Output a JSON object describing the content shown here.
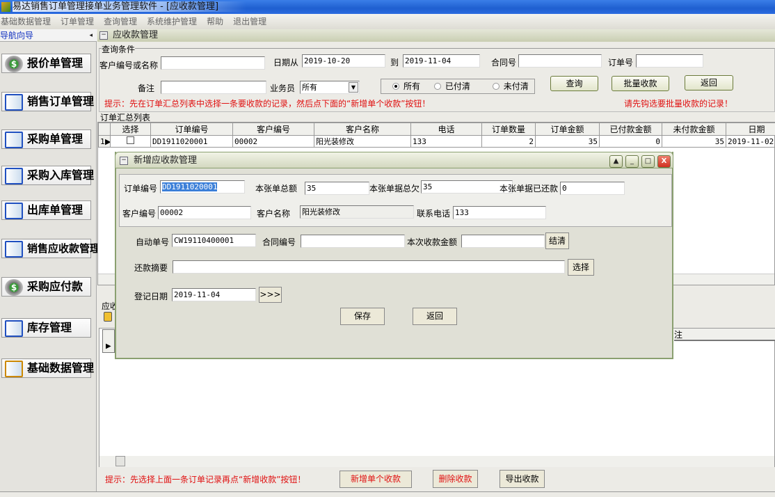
{
  "window": {
    "title": "易达销售订单管理接单业务管理软件 - [应收款管理]"
  },
  "menu": [
    "基础数据管理",
    "订单管理",
    "查询管理",
    "系统维护管理",
    "帮助",
    "退出管理"
  ],
  "nav": {
    "title": "导航向导",
    "collapse_icon": "◂"
  },
  "sidebar": [
    "报价单管理",
    "销售订单管理",
    "采购单管理",
    "采购入库管理",
    "出库单管理",
    "销售应收款管理",
    "采购应付款",
    "库存管理",
    "基础数据管理"
  ],
  "panel": {
    "title": "应收款管理"
  },
  "query": {
    "group_label": "查询条件",
    "customer_label": "客户编号或名称",
    "customer_value": "",
    "date_from_label": "日期从",
    "date_from": "2019-10-20",
    "date_to_label": "到",
    "date_to": "2019-11-04",
    "contract_label": "合同号",
    "contract_value": "",
    "order_label": "订单号",
    "order_value": "",
    "remark_label": "备注",
    "remark_value": "",
    "salesman_label": "业务员",
    "salesman_value": "所有",
    "radio_all": "所有",
    "radio_paid": "已付清",
    "radio_unpaid": "未付清",
    "search_btn": "查询",
    "batch_btn": "批量收款",
    "back_btn": "返回",
    "hint": "提示：先在订单汇总列表中选择一条要收款的记录，然后点下面的“新增单个收款”按钮！",
    "batch_hint": "请先钩选要批量收款的记录！"
  },
  "orders": {
    "label": "订单汇总列表",
    "columns": [
      "选择",
      "订单编号",
      "客户编号",
      "客户名称",
      "电话",
      "订单数量",
      "订单金额",
      "已付款金额",
      "未付款金额",
      "日期"
    ],
    "rows": [
      {
        "index": "1",
        "order_no": "DD1911020001",
        "cust_no": "00002",
        "cust_name": "阳光装修改",
        "phone": "133",
        "qty": "2",
        "amount": "35",
        "paid": "0",
        "unpaid": "35",
        "date": "2019-11-02"
      }
    ]
  },
  "receipts": {
    "label": "应收",
    "col_partial": "注"
  },
  "bottom": {
    "hint": "提示：先选择上面一条订单记录再点“新增收款”按钮！",
    "add_btn": "新增单个收款",
    "del_btn": "删除收款",
    "export_btn": "导出收款"
  },
  "dialog": {
    "title": "新增应收款管理",
    "order_no_label": "订单编号",
    "order_no": "DD1911020001",
    "total_label": "本张单总额",
    "total": "35",
    "owed_label": "本张单据总欠",
    "owed": "35",
    "repaid_label": "本张单据已还款",
    "repaid": "0",
    "cust_no_label": "客户编号",
    "cust_no": "00002",
    "cust_name_label": "客户名称",
    "cust_name": "阳光装修改",
    "phone_label": "联系电话",
    "phone": "133",
    "auto_no_label": "自动单号",
    "auto_no": "CW19110400001",
    "contract_label": "合同编号",
    "contract": "",
    "amount_label": "本次收款金额",
    "amount": "",
    "settle_btn": "结清",
    "summary_label": "还款摘要",
    "summary": "",
    "choose_btn": "选择",
    "date_label": "登记日期",
    "date": "2019-11-04",
    "date_btn": ">>>",
    "save_btn": "保存",
    "back_btn": "返回"
  }
}
